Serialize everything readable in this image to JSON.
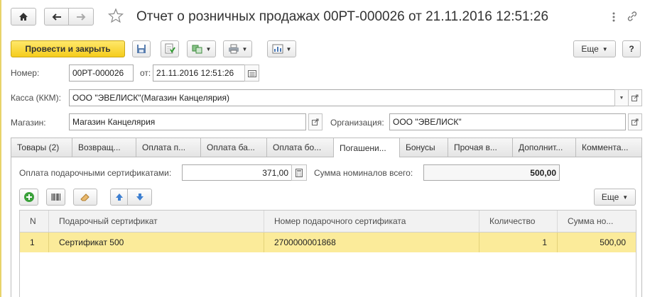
{
  "header": {
    "title": "Отчет о розничных продажах 00РТ-000026 от 21.11.2016 12:51:26"
  },
  "toolbar": {
    "post_close_label": "Провести и закрыть",
    "more_label": "Еще",
    "help_label": "?"
  },
  "form": {
    "number_label": "Номер:",
    "number_value": "00РТ-000026",
    "date_label": "от:",
    "date_value": "21.11.2016 12:51:26",
    "cash_label": "Касса (ККМ):",
    "cash_value": "ООО \"ЭВЕЛИСК\"(Магазин Канцелярия)",
    "store_label": "Магазин:",
    "store_value": "Магазин Канцелярия",
    "org_label": "Организация:",
    "org_value": "ООО \"ЭВЕЛИСК\""
  },
  "tabs": [
    {
      "label": "Товары (2)"
    },
    {
      "label": "Возвращ..."
    },
    {
      "label": "Оплата п..."
    },
    {
      "label": "Оплата ба..."
    },
    {
      "label": "Оплата бо..."
    },
    {
      "label": "Погашени..."
    },
    {
      "label": "Бонусы"
    },
    {
      "label": "Прочая в..."
    },
    {
      "label": "Дополнит..."
    },
    {
      "label": "Коммента..."
    }
  ],
  "active_tab": 5,
  "certificates": {
    "payment_label": "Оплата подарочными сертификатами:",
    "payment_value": "371,00",
    "nominal_label": "Сумма номиналов всего:",
    "nominal_value": "500,00",
    "more_label": "Еще",
    "columns": [
      "N",
      "Подарочный сертификат",
      "Номер подарочного сертификата",
      "Количество",
      "Сумма но..."
    ],
    "rows": [
      [
        "1",
        "Сертификат 500",
        "2700000001868",
        "1",
        "500,00"
      ]
    ]
  },
  "colors": {
    "primary_button": "#f5cc1c",
    "selected_row": "#fbeb9a",
    "add_icon": "#3aa13a",
    "arrow_icon": "#3d7fd1"
  }
}
